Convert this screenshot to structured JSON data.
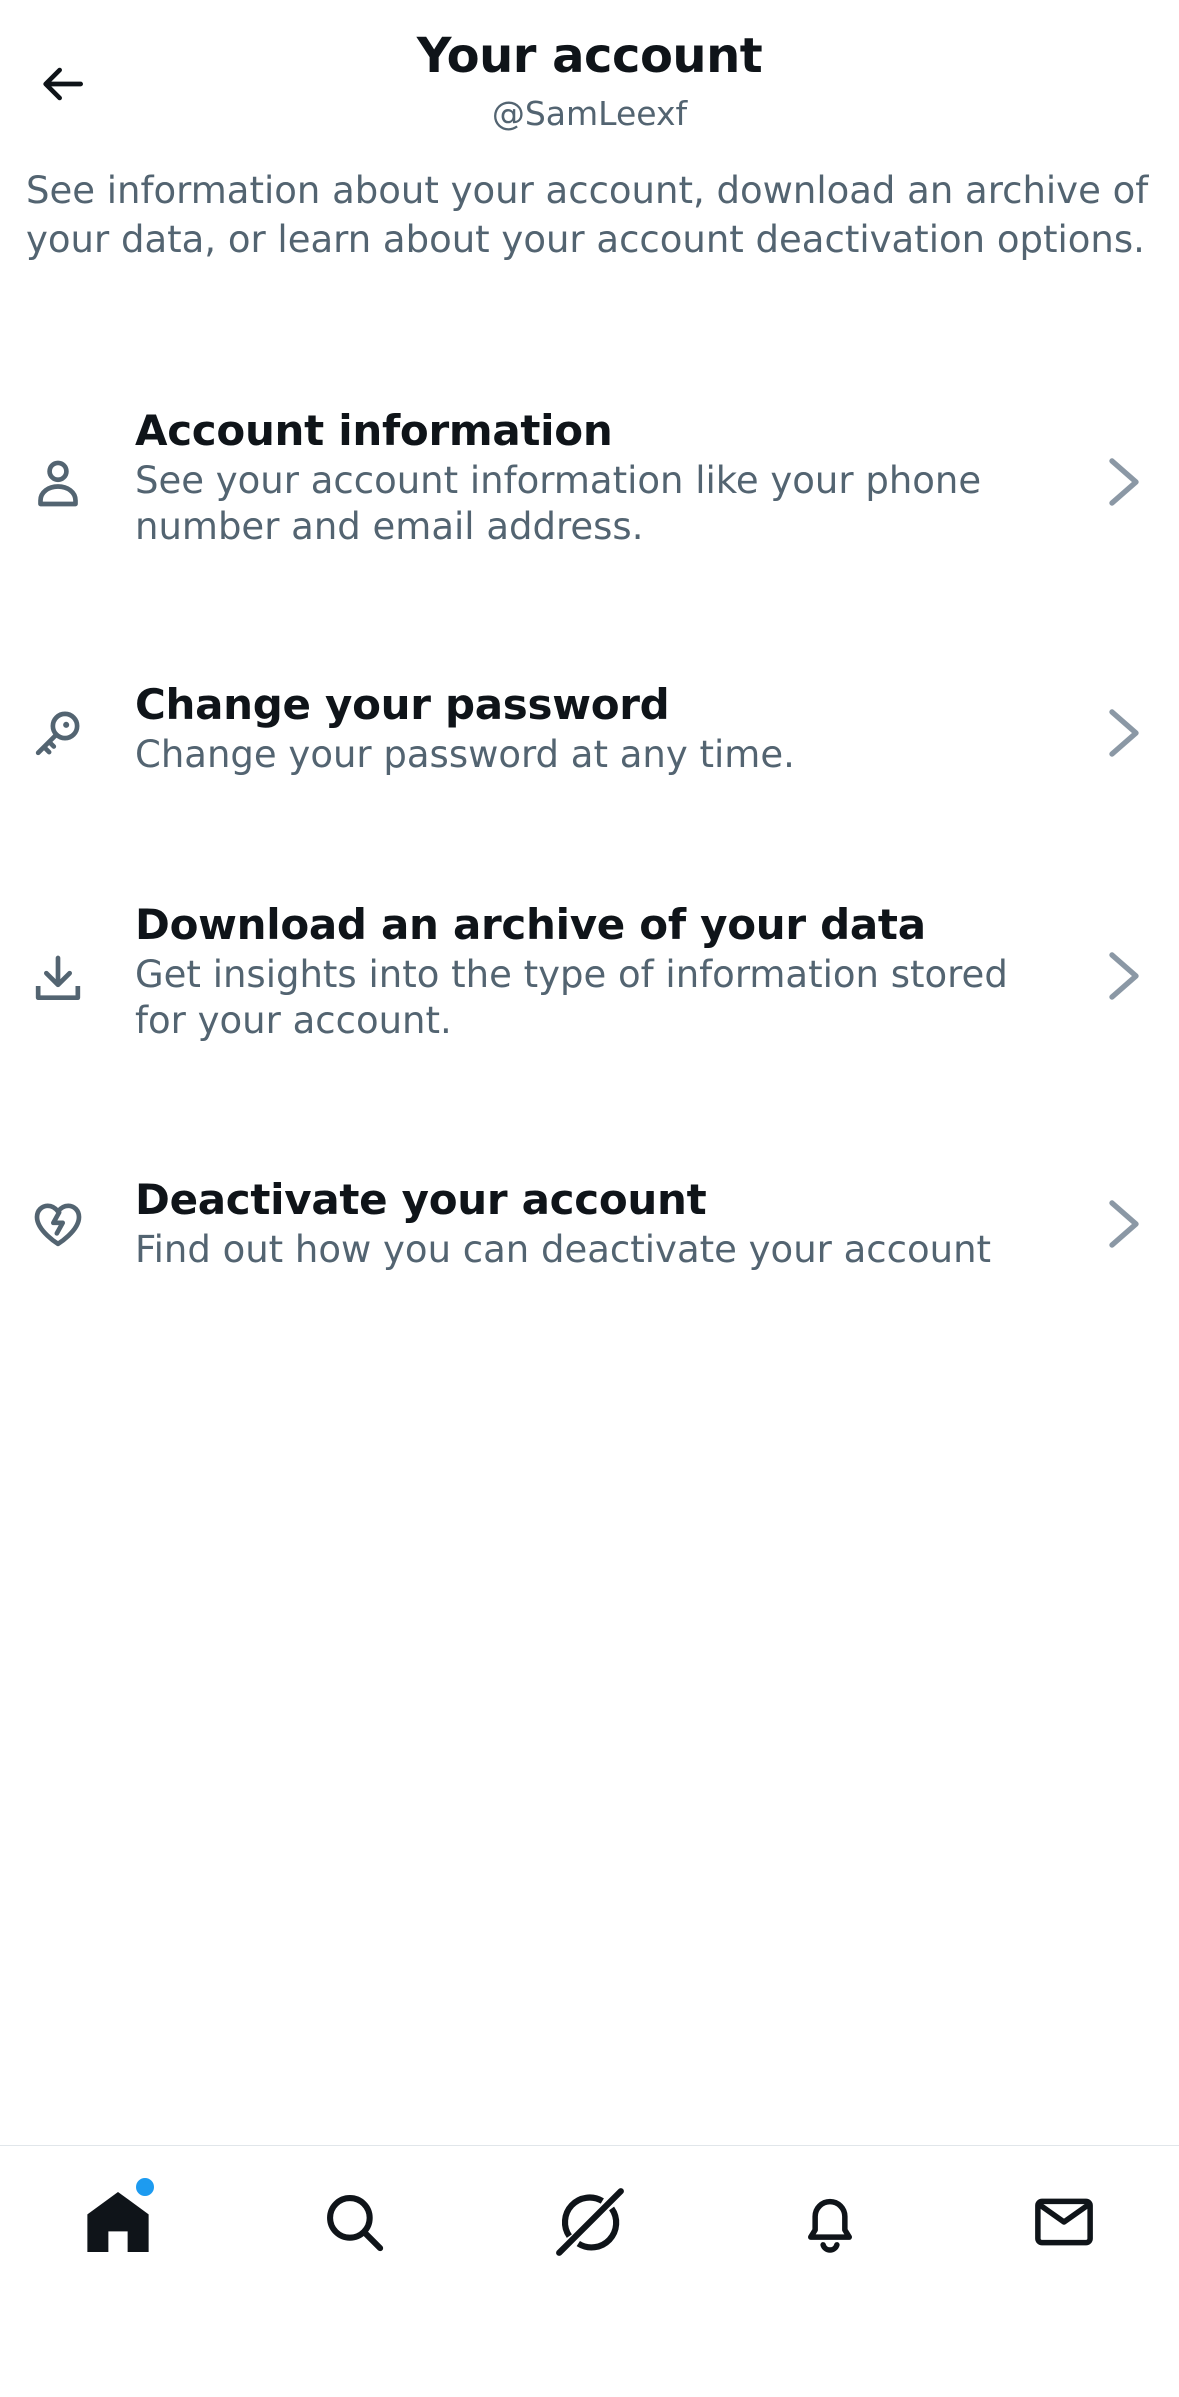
{
  "header": {
    "title": "Your account",
    "handle": "@SamLeexf"
  },
  "description": "See information about your account, download an archive of your data, or learn about your account deactivation options.",
  "items": [
    {
      "icon": "person-icon",
      "title": "Account information",
      "subtitle": "See your account information like your phone number and email address."
    },
    {
      "icon": "key-icon",
      "title": "Change your password",
      "subtitle": "Change your password at any time."
    },
    {
      "icon": "download-icon",
      "title": "Download an archive of your data",
      "subtitle": "Get insights into the type of information stored for your account."
    },
    {
      "icon": "broken-heart-icon",
      "title": "Deactivate your account",
      "subtitle": "Find out how you can deactivate your account"
    }
  ],
  "tabbar": {
    "tabs": [
      "home-icon",
      "search-icon",
      "grok-icon",
      "bell-icon",
      "mail-icon"
    ],
    "home_has_notification": true
  },
  "colors": {
    "text_primary": "#0f1419",
    "text_secondary": "#536471",
    "chevron": "#8b98a5",
    "accent": "#1d9bf0"
  }
}
